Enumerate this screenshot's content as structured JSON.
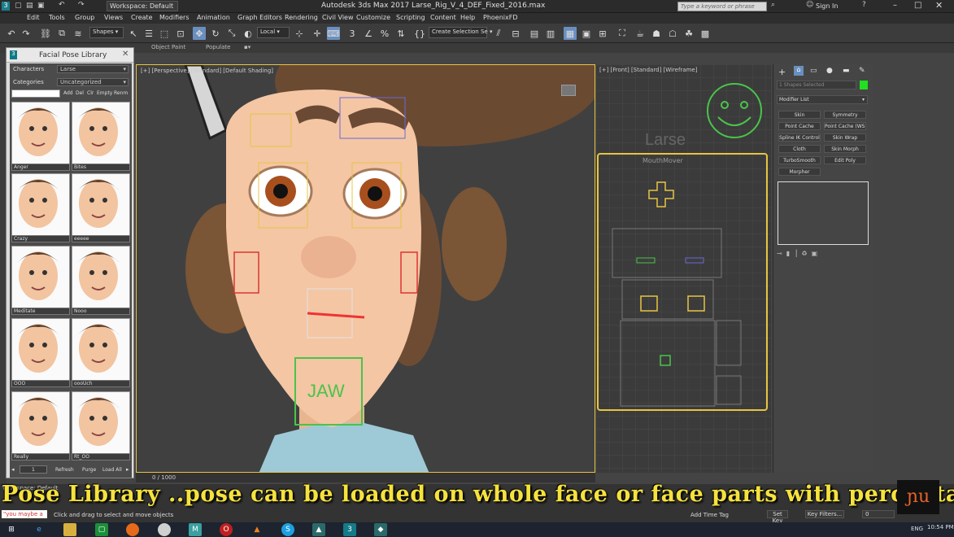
{
  "window": {
    "workspace_label": "Workspace: Default",
    "app_title": "Autodesk 3ds Max 2017",
    "file_name": "Larse_Rig_V_4_DEF_Fixed_2016.max",
    "search_placeholder": "Type a keyword or phrase",
    "sign_in": "Sign In"
  },
  "menu": [
    "Edit",
    "Tools",
    "Group",
    "Views",
    "Create",
    "Modifiers",
    "Animation",
    "Graph Editors",
    "Rendering",
    "Civil View",
    "Customize",
    "Scripting",
    "Content",
    "Help",
    "PhoenixFD"
  ],
  "toolbar": {
    "selection_filter": "Shapes",
    "coord_system": "Local",
    "named_selection": "Create Selection Se"
  },
  "ribbon": {
    "object_paint": "Object Paint",
    "populate": "Populate"
  },
  "pose_library": {
    "title": "Facial Pose Library",
    "characters_label": "Characters",
    "characters_value": "Larse",
    "categories_label": "Categories",
    "categories_value": "Uncategorized",
    "buttons": [
      "Add",
      "Del",
      "Clr",
      "Empty",
      "Renm"
    ],
    "poses": [
      "Anger",
      "Bites",
      "Crazy",
      "eeeee",
      "Meditate",
      "Nooo",
      "OOO",
      "oooUch",
      "Really",
      "Rt_OO"
    ],
    "bottom_value": "1",
    "refresh": "Refresh",
    "purge": "Purge",
    "load_all": "Load All"
  },
  "viewports": {
    "perspective_label": "[+] [Perspective] [Standard] [Default Shading]",
    "front_label": "[+] [Front] [Standard] [Wireframe]",
    "front_larse": "Larse",
    "front_mouthmover": "MouthMover",
    "jaw_label": "JAW"
  },
  "command_panel": {
    "selection": "1 Shapes Selected",
    "modifier_list": "Modifier List",
    "modifiers": [
      "Skin",
      "Symmetry",
      "Point Cache",
      "Point Cache (WSM)",
      "Spline IK Control",
      "Skin Wrap",
      "Cloth",
      "Skin Morph",
      "TurboSmooth",
      "Edit Poly",
      "Morpher"
    ]
  },
  "timeline": {
    "frame": "0 / 1000"
  },
  "status": {
    "workspace": "Workspace: Default",
    "maxscript": "\"you maybe a",
    "prompt": "Click and drag to select and move objects",
    "add_time_tag": "Add Time Tag",
    "set_key": "Set Key",
    "key_filters": "Key Filters...",
    "key_value": "0"
  },
  "caption": "Pose Library ..pose can be loaded on whole face or face parts with percentage",
  "taskbar": {
    "lang": "ENG",
    "time": "10:54 PM"
  },
  "colors": {
    "accent_select": "#6a8fbf",
    "viewport_border": "#e8c443",
    "caption": "#f5e23c",
    "green_swatch": "#20e020"
  }
}
